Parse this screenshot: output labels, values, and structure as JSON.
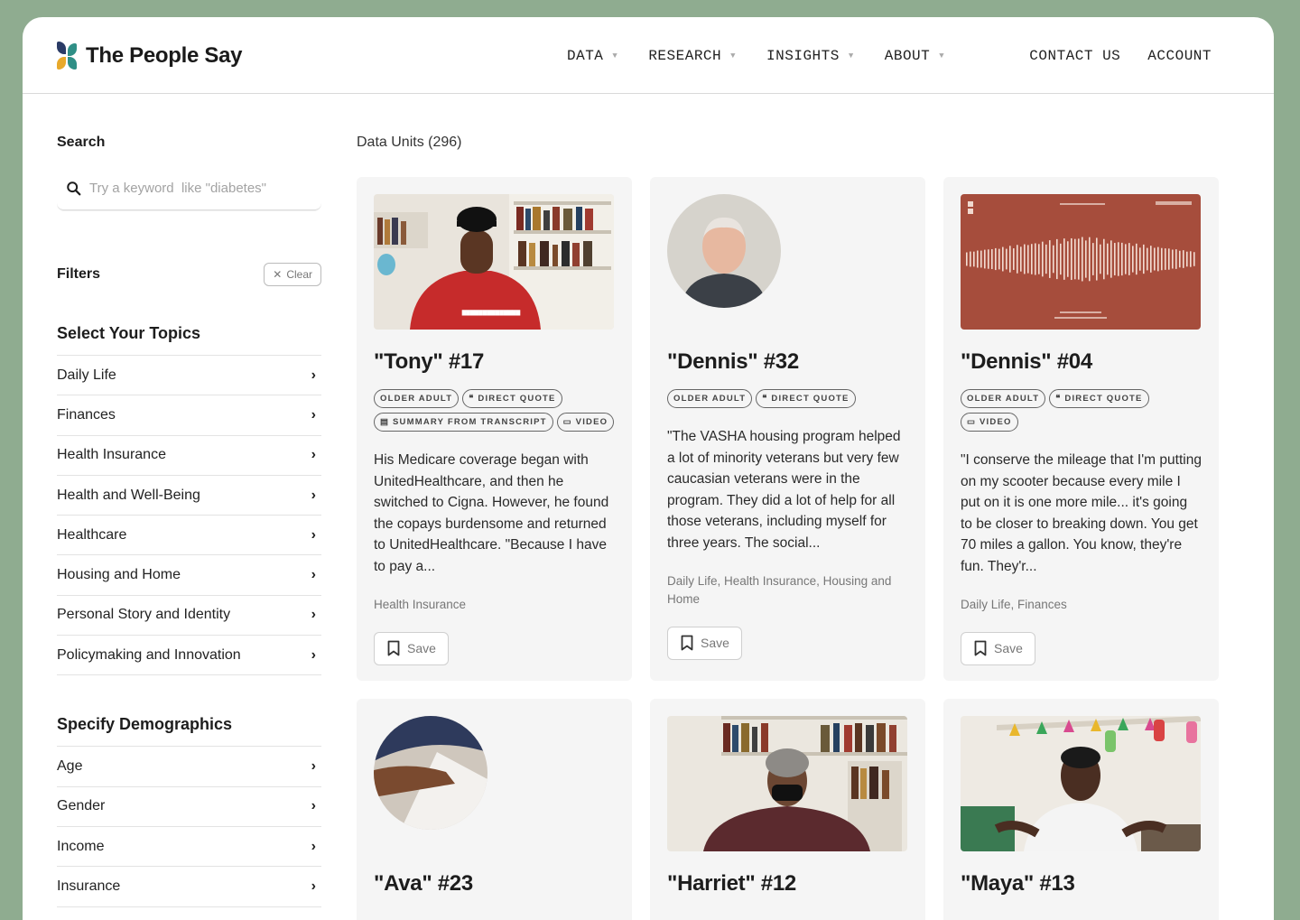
{
  "brand": {
    "name": "The People Say",
    "colors": {
      "teal": "#2f8f86",
      "gold": "#e8a92b",
      "navy": "#2a3b66",
      "red": "#c9533d"
    }
  },
  "nav": {
    "items": [
      {
        "label": "DATA"
      },
      {
        "label": "RESEARCH"
      },
      {
        "label": "INSIGHTS"
      },
      {
        "label": "ABOUT"
      }
    ],
    "contact": "CONTACT US",
    "account": "ACCOUNT"
  },
  "sidebar": {
    "search_label": "Search",
    "search_placeholder": "Try a keyword  like \"diabetes\"",
    "filters_label": "Filters",
    "clear_label": "Clear",
    "topics_title": "Select Your Topics",
    "topics": [
      "Daily Life",
      "Finances",
      "Health Insurance",
      "Health and Well-Being",
      "Healthcare",
      "Housing and Home",
      "Personal Story and Identity",
      "Policymaking and Innovation"
    ],
    "demographics_title": "Specify Demographics",
    "demographics": [
      "Age",
      "Gender",
      "Income",
      "Insurance"
    ]
  },
  "main": {
    "units_title": "Data Units (296)",
    "save_label": "Save",
    "cards": [
      {
        "title": "\"Tony\" #17",
        "tags": [
          "Older Adult",
          "Direct Quote",
          "Summary From Transcript",
          "Video"
        ],
        "description": "His Medicare coverage began with UnitedHealthcare, and then he switched to Cigna. However, he found the copays burdensome and returned to UnitedHealthcare. \"Because I have to pay a...",
        "categories": "Health Insurance"
      },
      {
        "title": "\"Dennis\" #32",
        "tags": [
          "Older Adult",
          "Direct Quote"
        ],
        "description": "\"The VASHA housing program helped a lot of minority veterans but very few caucasian veterans were in the program. They did a lot of help for all those veterans, including myself for three years. The social...",
        "categories": "Daily Life, Health Insurance, Housing and Home"
      },
      {
        "title": "\"Dennis\" #04",
        "tags": [
          "Older Adult",
          "Direct Quote",
          "Video"
        ],
        "description": "\"I conserve the mileage that I'm putting on my scooter because every mile I put on it is one more mile... it's going to be closer to breaking down. You get 70 miles a gallon. You know, they're fun. They'r...",
        "categories": "Daily Life, Finances"
      },
      {
        "title": "\"Ava\" #23"
      },
      {
        "title": "\"Harriet\" #12"
      },
      {
        "title": "\"Maya\" #13"
      }
    ]
  }
}
